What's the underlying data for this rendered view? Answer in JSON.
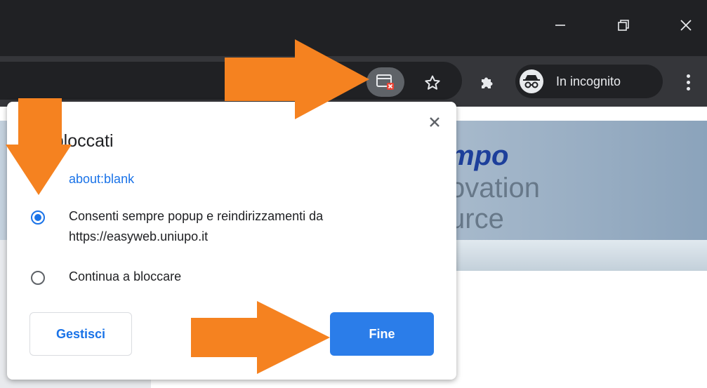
{
  "window": {
    "minimize_icon": "minimize-icon",
    "restore_icon": "restore-icon",
    "close_icon": "close-icon"
  },
  "toolbar": {
    "popup_blocked_icon": "popup-blocked-icon",
    "bookmark_icon": "star-icon",
    "extensions_icon": "puzzle-icon",
    "incognito_label": "In incognito",
    "menu_icon": "more-vert-icon"
  },
  "page": {
    "logo_line1": "mpo",
    "logo_line2": "ovation",
    "logo_line3": "urce"
  },
  "dialog": {
    "title": "up bloccati",
    "blocked_url": "about:blank",
    "options": [
      {
        "label": "Consenti sempre popup e reindirizzamenti da https://easyweb.uniupo.it",
        "selected": true
      },
      {
        "label": "Continua a bloccare",
        "selected": false
      }
    ],
    "manage_button": "Gestisci",
    "done_button": "Fine"
  },
  "colors": {
    "accent": "#1a73e8",
    "annotation": "#f58220",
    "toolbar": "#35363a",
    "titlebar": "#202124"
  }
}
